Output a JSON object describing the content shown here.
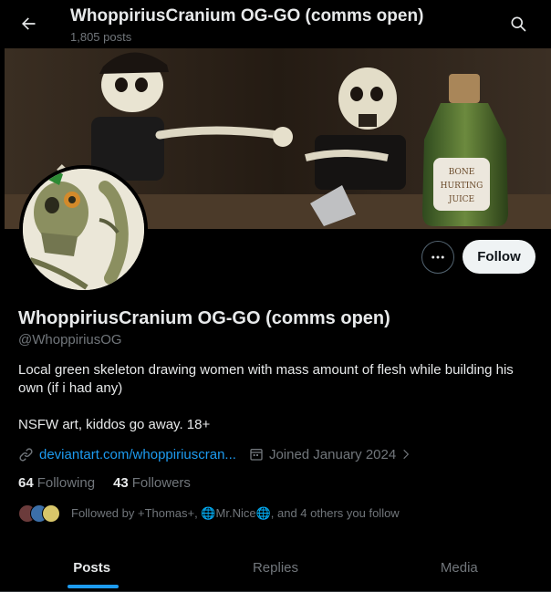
{
  "header": {
    "title": "WhoppiriusCranium OG-GO (comms open)",
    "posts_count": "1,805 posts",
    "back_icon": "arrow-left-icon",
    "search_icon": "search-icon"
  },
  "banner": {
    "bottle_label_lines": [
      "BONE",
      "HURTING",
      "JUICE"
    ]
  },
  "profile": {
    "name": "WhoppiriusCranium OG-GO (comms open)",
    "handle": "@WhoppiriusOG",
    "bio_lines": [
      "Local green skeleton drawing women with mass amount of flesh while building his own (if i had any)",
      "NSFW art, kiddos go away. 18+"
    ],
    "website": "deviantart.com/whoppiriuscran...",
    "joined": "Joined January 2024",
    "following_count": "64",
    "following_label": "Following",
    "followers_count": "43",
    "followers_label": "Followers",
    "followed_by": "Followed by +Thomas+, 🌐Mr.Nice🌐, and 4 others you follow"
  },
  "actions": {
    "more_label": "•••",
    "follow_label": "Follow"
  },
  "tabs": [
    {
      "label": "Posts",
      "active": true
    },
    {
      "label": "Replies",
      "active": false
    },
    {
      "label": "Media",
      "active": false
    }
  ],
  "colors": {
    "accent": "#1d9bf0",
    "background": "#000000",
    "text": "#e7e9ea",
    "muted": "#71767b"
  }
}
